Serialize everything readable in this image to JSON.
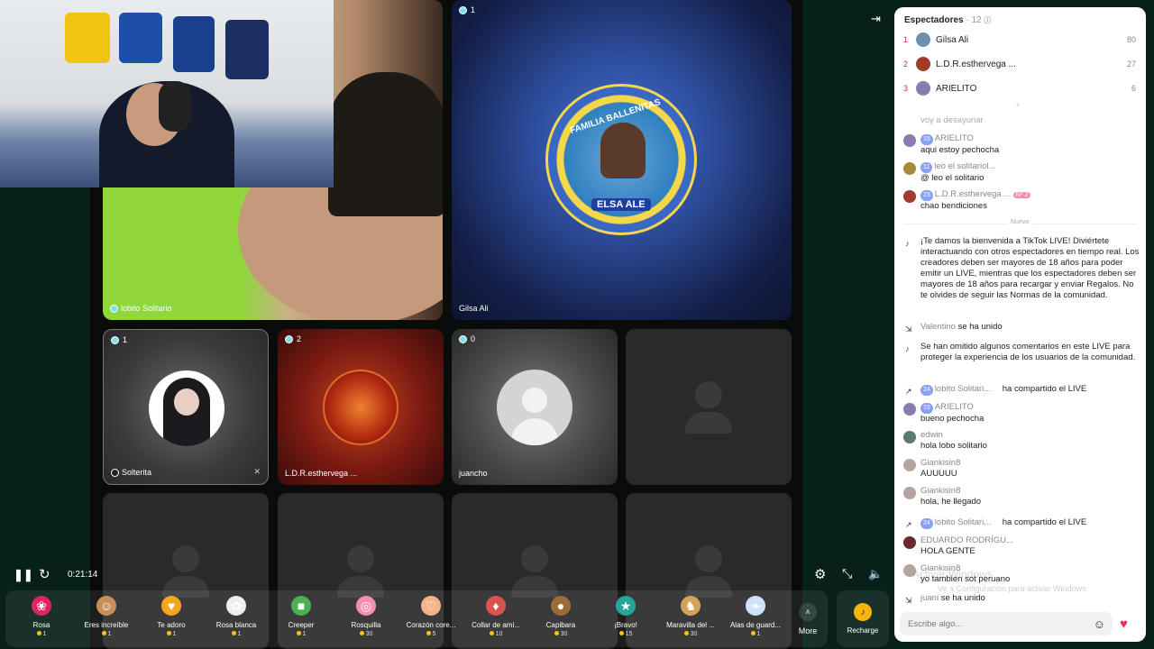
{
  "controls": {
    "time": "0:21:14",
    "more_label": "More",
    "recharge_label": "Recharge"
  },
  "tiles": {
    "t_main": {
      "name": "lobito Solitario"
    },
    "t_gilsa": {
      "name": "Gilsa Ali",
      "badge": "1",
      "banner_top": "FAMILIA BALLENITAS",
      "banner_bottom": "ELSA ALE"
    },
    "t_solterita": {
      "name": "Solterita",
      "badge": "1"
    },
    "t_ldr": {
      "name": "L.D.R.esthervega ...",
      "badge": "2"
    },
    "t_juancho": {
      "name": "juancho",
      "badge": "0"
    }
  },
  "gifts": [
    {
      "name": "Rosa",
      "coins": "1",
      "icon": "rose-icon",
      "color": "#e0245e"
    },
    {
      "name": "Eres increíble",
      "coins": "1",
      "icon": "cat-icon",
      "color": "#c98f5a"
    },
    {
      "name": "Te adoro",
      "coins": "1",
      "icon": "heart-face-icon",
      "color": "#f4a623"
    },
    {
      "name": "Rosa blanca",
      "coins": "1",
      "icon": "white-rose-icon",
      "color": "#eeeeee"
    },
    {
      "name": "Creeper",
      "coins": "1",
      "icon": "creeper-icon",
      "color": "#4caf50"
    },
    {
      "name": "Rosquilla",
      "coins": "30",
      "icon": "donut-icon",
      "color": "#f48fb1"
    },
    {
      "name": "Corazón core...",
      "coins": "5",
      "icon": "finger-heart-icon",
      "color": "#f5b38a"
    },
    {
      "name": "Collar de ami...",
      "coins": "10",
      "icon": "necklace-icon",
      "color": "#d9534f"
    },
    {
      "name": "Capibara",
      "coins": "30",
      "icon": "capybara-icon",
      "color": "#9c6b3a"
    },
    {
      "name": "¡Bravo!",
      "coins": "15",
      "icon": "bravo-icon",
      "color": "#26a69a"
    },
    {
      "name": "Maravilla del ...",
      "coins": "30",
      "icon": "deer-icon",
      "color": "#d4a35a"
    },
    {
      "name": "Alas de guard...",
      "coins": "1",
      "icon": "wings-icon",
      "color": "#cfe3ff"
    }
  ],
  "panel": {
    "title": "Espectadores",
    "count": "· 12",
    "ranks": [
      {
        "n": "1",
        "name": "Gilsa Ali",
        "score": "80",
        "color": "#6a8fb0"
      },
      {
        "n": "2",
        "name": "L.D.R.esthervega ...",
        "score": "27",
        "color": "#a33a2a"
      },
      {
        "n": "3",
        "name": "ARIELITO",
        "score": "6",
        "color": "#8a7ab0"
      }
    ],
    "nuevo": "Nuevo",
    "partial": "voy a desayunar",
    "m1": {
      "lvl": "15",
      "user": "ARIELITO",
      "text": "aqui estoy pechocha"
    },
    "m2": {
      "lvl": "11",
      "user": "leo el solitariol...",
      "text": "@ leo el solitario"
    },
    "m3": {
      "lvl": "23",
      "user": "L.D.R.esthervega ...",
      "rank": "Nº 2",
      "text": "chao bendiciones"
    },
    "sys1": "¡Te damos la bienvenida a TikTok LIVE! Diviértete interactuando con otros espectadores en tiempo real. Los creadores deben ser mayores de 18 años para poder emitir un LIVE, mientras que los espectadores deben ser mayores de 18 años para recargar y enviar Regalos. No te olvides de seguir las Normas de la comunidad.",
    "j1": {
      "user": "Valentino",
      "text": "se ha unido"
    },
    "sys2": "Se han omitido algunos comentarios en este LIVE para proteger la experiencia de los usuarios de la comunidad.",
    "s1": {
      "lvl": "24",
      "user": "lobito Solitari...",
      "text": "ha compartido el LIVE"
    },
    "m4": {
      "lvl": "15",
      "user": "ARIELITO",
      "text": "bueno pechocha"
    },
    "m5": {
      "user": "edwin",
      "text": "hola lobo solitario"
    },
    "m6": {
      "user": "Giankisin8",
      "text": "AUUUUU"
    },
    "m7": {
      "user": "Giankisin8",
      "text": "hola, he llegado"
    },
    "s2": {
      "lvl": "24",
      "user": "lobito Solitari...",
      "text": "ha compartido el LIVE"
    },
    "m8": {
      "user": "EDUARDO RODRÍGU...",
      "text": "HOLA GENTE"
    },
    "m9": {
      "user": "Giankisin8",
      "text": "yo tambien sot peruano"
    },
    "j2": {
      "user": "juani",
      "text": "se ha unido"
    },
    "input_placeholder": "Escribe algo...",
    "watermark1": "Activar Windows",
    "watermark2": "Ve a Configuración para activar Windows."
  }
}
